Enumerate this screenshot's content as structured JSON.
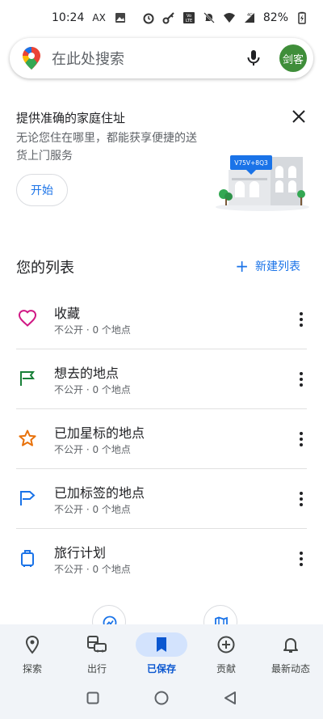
{
  "status_bar": {
    "time": "10:24",
    "ax": "AX",
    "battery": "82%"
  },
  "search": {
    "placeholder": "在此处搜索",
    "avatar_text": "剑客"
  },
  "promo": {
    "title": "提供准确的家庭住址",
    "description": "无论您住在哪里，都能获享便捷的送货上门服务",
    "button": "开始",
    "illustration_label": "V75V+8Q3"
  },
  "lists": {
    "title": "您的列表",
    "new_list": "新建列表",
    "items": [
      {
        "name": "收藏",
        "subtitle": "不公开 · 0 个地点",
        "icon": "heart-icon",
        "color": "#d01884"
      },
      {
        "name": "想去的地点",
        "subtitle": "不公开 · 0 个地点",
        "icon": "flag-icon",
        "color": "#188038"
      },
      {
        "name": "已加星标的地点",
        "subtitle": "不公开 · 0 个地点",
        "icon": "star-icon",
        "color": "#e8710a"
      },
      {
        "name": "已加标签的地点",
        "subtitle": "不公开 · 0 个地点",
        "icon": "label-flag-icon",
        "color": "#1a73e8"
      },
      {
        "name": "旅行计划",
        "subtitle": "不公开 · 0 个地点",
        "icon": "suitcase-icon",
        "color": "#1a73e8"
      }
    ]
  },
  "bottom_nav": {
    "items": [
      {
        "label": "探索",
        "icon": "location-pin-icon"
      },
      {
        "label": "出行",
        "icon": "commute-icon"
      },
      {
        "label": "已保存",
        "icon": "bookmark-icon",
        "active": true
      },
      {
        "label": "贡献",
        "icon": "add-circle-icon"
      },
      {
        "label": "最新动态",
        "icon": "bell-icon"
      }
    ]
  },
  "colors": {
    "accent": "#1a73e8",
    "nav_bg": "#f1f4f8",
    "nav_active_pill": "#d3e3fd",
    "avatar_bg": "#3f8e3a"
  }
}
